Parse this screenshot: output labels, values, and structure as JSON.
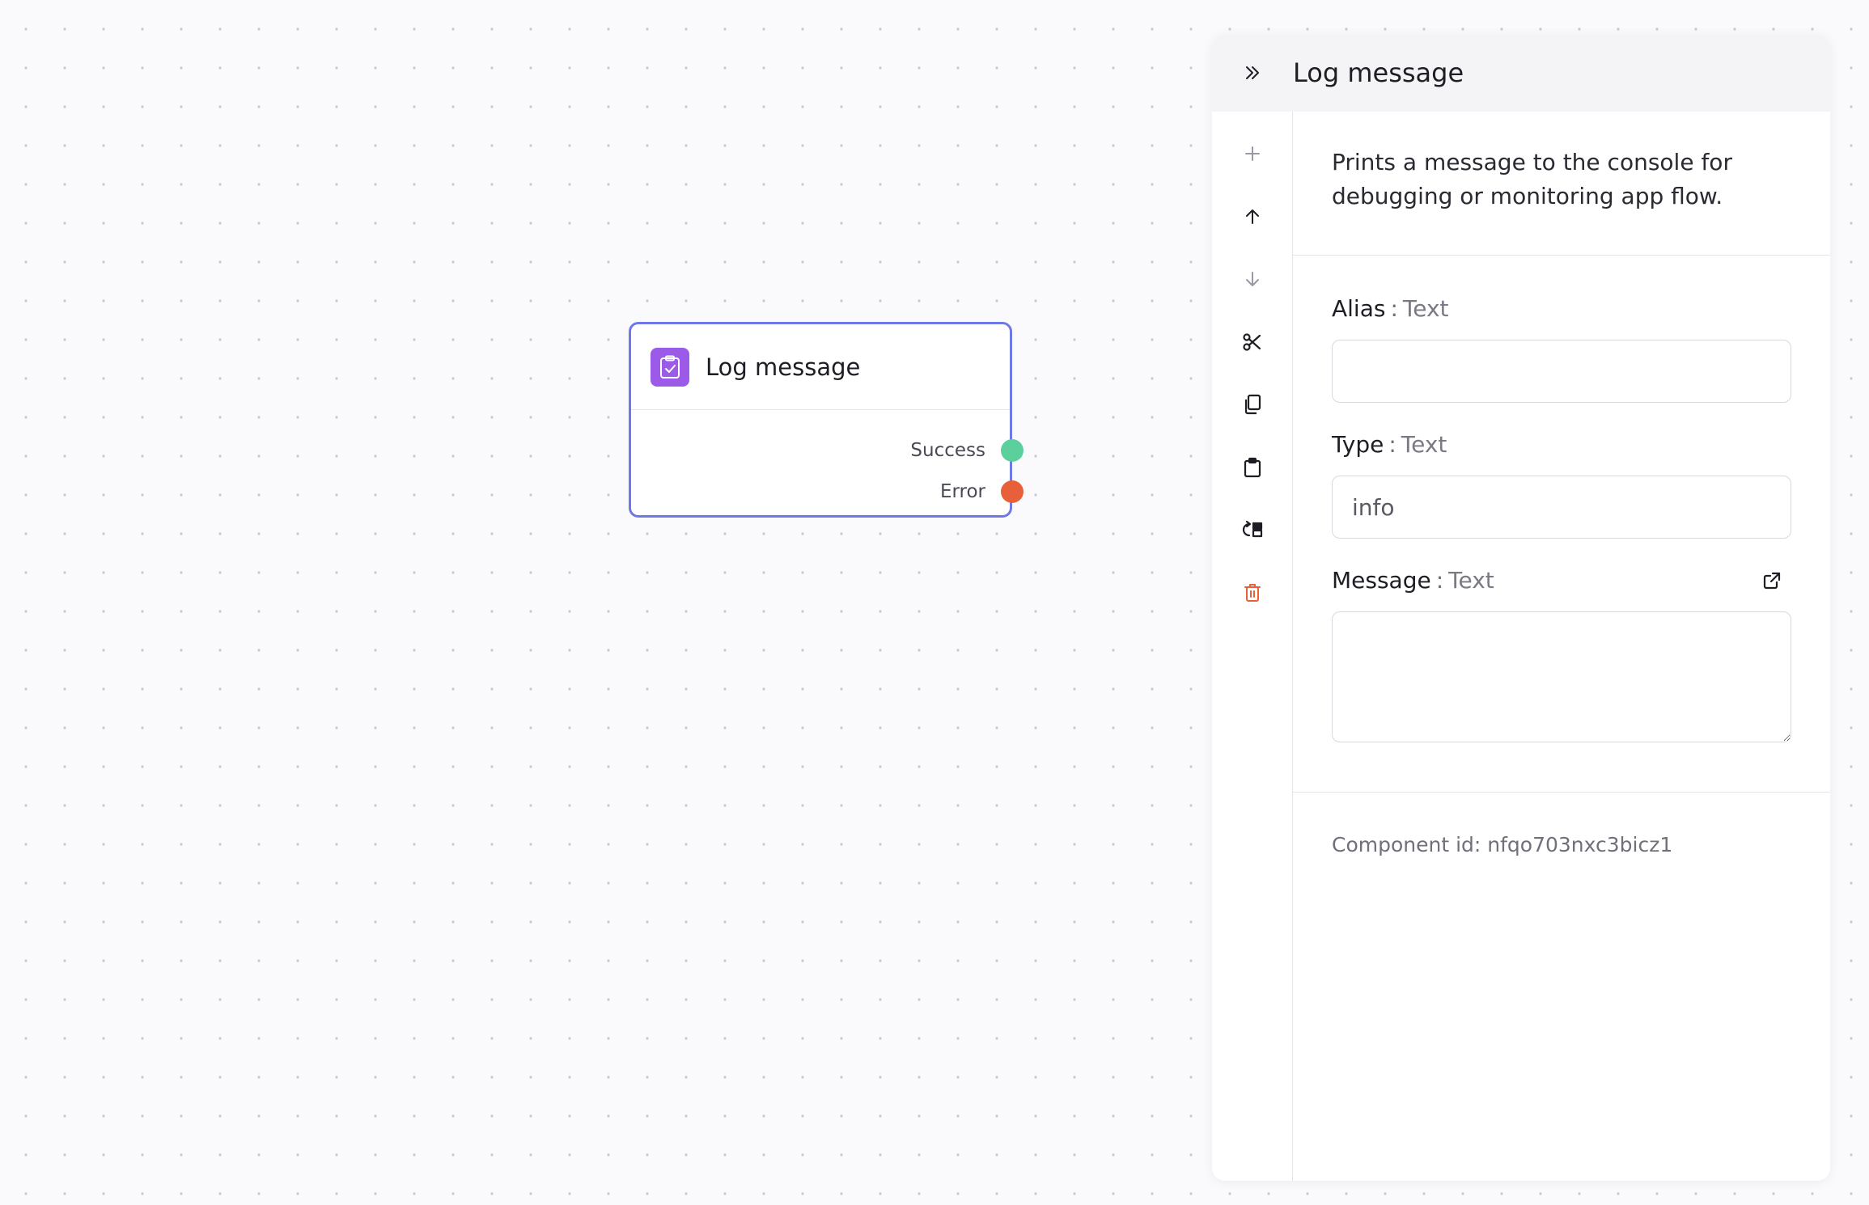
{
  "canvas": {
    "node": {
      "title": "Log message",
      "icon": "clipboard-check-icon",
      "ports": [
        {
          "label": "Success",
          "color": "#5bcf9c"
        },
        {
          "label": "Error",
          "color": "#e8603a"
        }
      ]
    }
  },
  "panel": {
    "title": "Log message",
    "description": "Prints a message to the console for debugging or monitoring app flow.",
    "toolbar": {
      "icons": [
        "plus-icon",
        "arrow-up-icon",
        "arrow-down-icon",
        "scissors-icon",
        "copy-icon",
        "clipboard-icon",
        "swap-icon",
        "trash-icon"
      ]
    },
    "fields": {
      "alias": {
        "label": "Alias",
        "sep": ":",
        "type": "Text",
        "value": ""
      },
      "type": {
        "label": "Type",
        "sep": ":",
        "type": "Text",
        "value": "info"
      },
      "message": {
        "label": "Message",
        "sep": ":",
        "type": "Text",
        "value": ""
      }
    },
    "component_id": "Component id: nfqo703nxc3bicz1"
  },
  "colors": {
    "accent": "#6e79e6",
    "node_icon_bg": "#9b5be8",
    "danger": "#e8603a",
    "success": "#5bcf9c"
  }
}
